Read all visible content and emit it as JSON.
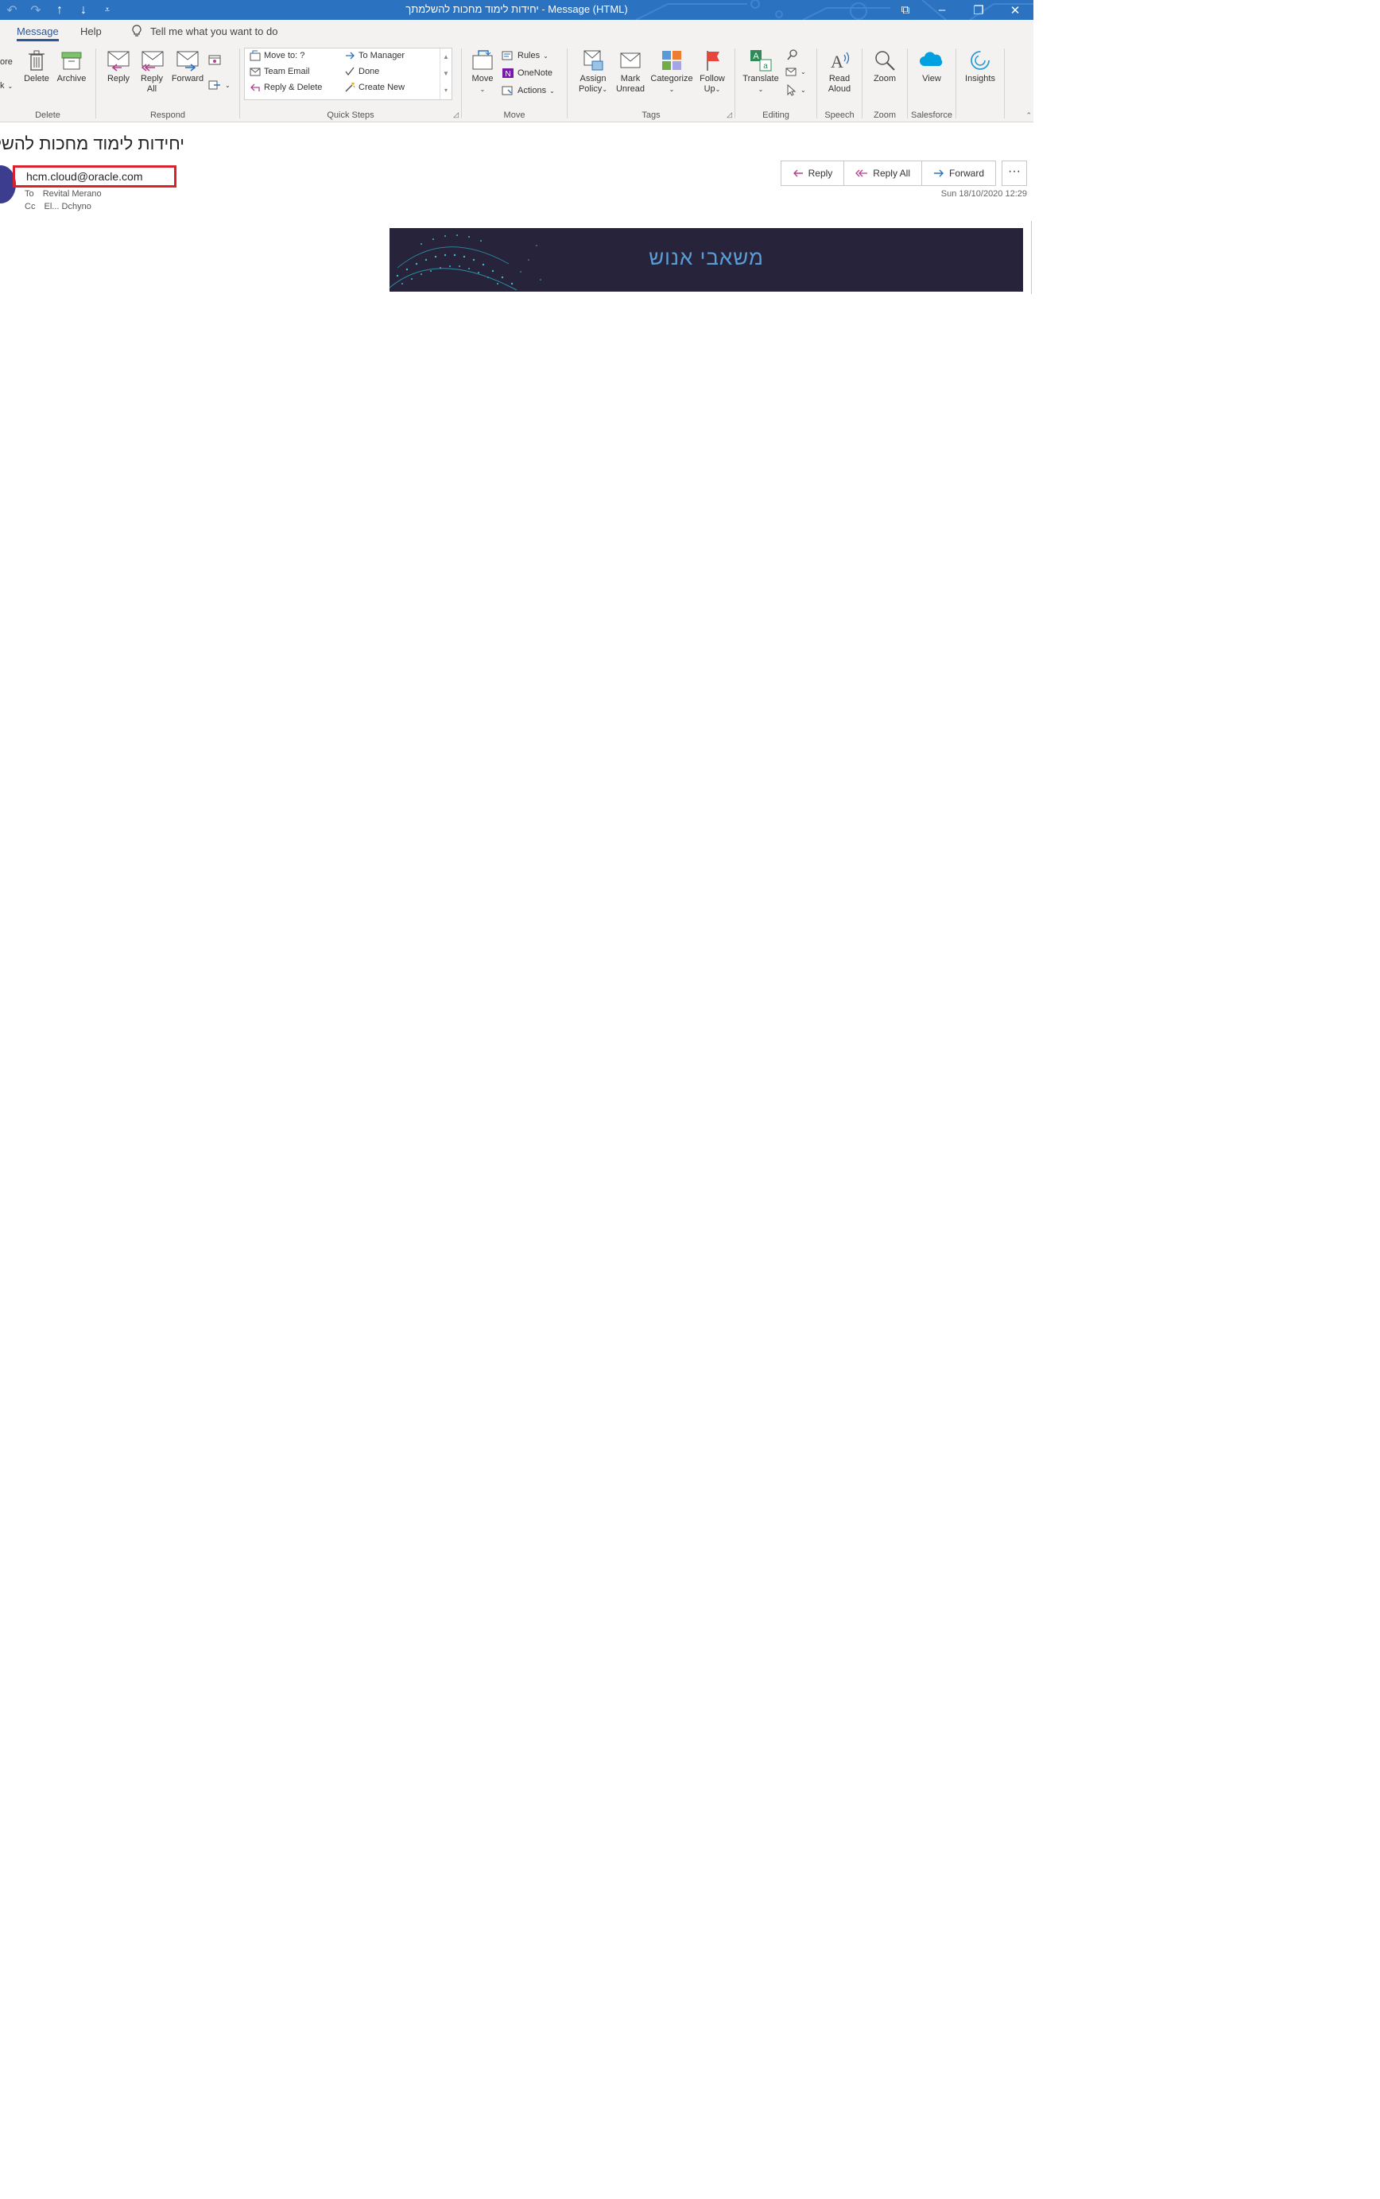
{
  "window": {
    "title": "יחידות לימוד מחכות להשלמתך  -  Message (HTML)",
    "controls": [
      "⧉",
      "–",
      "❐",
      "✕"
    ]
  },
  "qat": {
    "glyphs": [
      "↶",
      "↷",
      "↑",
      "↓",
      "⩡"
    ]
  },
  "tabs": [
    {
      "label": "Message",
      "active": true
    },
    {
      "label": "Help",
      "active": false
    }
  ],
  "tellme": {
    "placeholder": "Tell me what you want to do"
  },
  "ribbon": {
    "delete": {
      "label": "Delete",
      "ignore_partial": "ore",
      "junk_partial": "k",
      "delete_label": "Delete",
      "archive_label": "Archive"
    },
    "respond": {
      "label": "Respond",
      "reply_label": "Reply",
      "reply_all_label_1": "Reply",
      "reply_all_label_2": "All",
      "forward_label": "Forward"
    },
    "quicksteps": {
      "label": "Quick Steps",
      "items": [
        "Move to: ?",
        "Team Email",
        "Reply & Delete",
        "To Manager",
        "Done",
        "Create New"
      ]
    },
    "move": {
      "label": "Move",
      "move_label": "Move",
      "rules_label": "Rules",
      "onenote_label": "OneNote",
      "actions_label": "Actions"
    },
    "tags": {
      "label": "Tags",
      "assign_policy_1": "Assign",
      "assign_policy_2": "Policy",
      "mark_unread_1": "Mark",
      "mark_unread_2": "Unread",
      "categorize_label": "Categorize",
      "follow_up_1": "Follow",
      "follow_up_2": "Up"
    },
    "editing": {
      "label": "Editing",
      "translate_label": "Translate"
    },
    "speech": {
      "label": "Speech",
      "read_aloud_1": "Read",
      "read_aloud_2": "Aloud"
    },
    "zoom": {
      "label": "Zoom",
      "zoom_label": "Zoom"
    },
    "salesforce": {
      "label": "Salesforce",
      "view_label": "View"
    },
    "insights": {
      "label": "Insights"
    }
  },
  "message": {
    "subject": "יחידות לימוד מחכות להשלמתך",
    "sender": "hcm.cloud@oracle.com",
    "to_label": "To",
    "to_value": "Revital Merano",
    "cc_label": "Cc",
    "cc_value": "El...  Dchyno",
    "reply_label": "Reply",
    "reply_all_label": "Reply All",
    "forward_label": "Forward",
    "more_label": "···",
    "date": "Sun 18/10/2020 12:29",
    "banner_text": "משאבי אנוש"
  },
  "colors": {
    "titlebar": "#2b72c0",
    "ribbon": "#f3f2f1",
    "highlight": "#d9222b",
    "banner": "#27233a",
    "banner_text": "#5a9cd6"
  }
}
